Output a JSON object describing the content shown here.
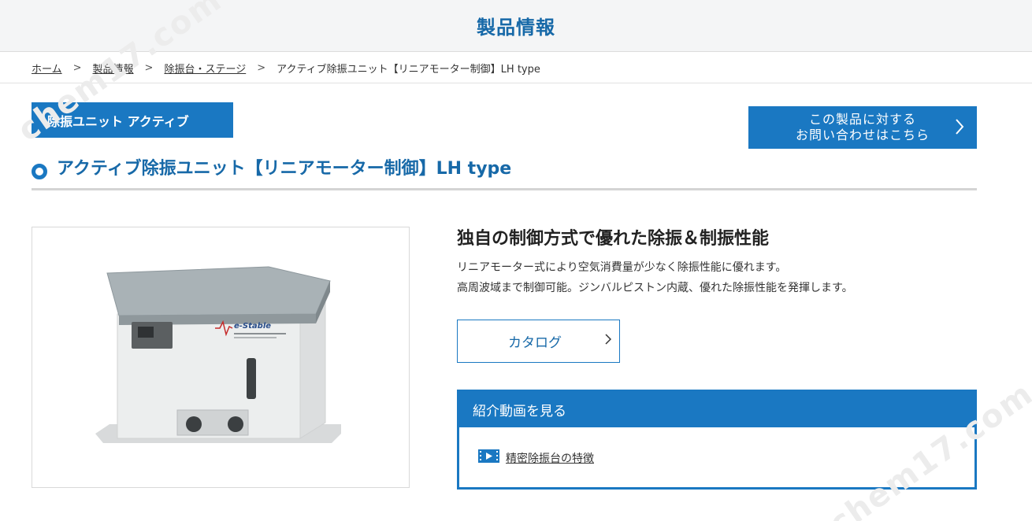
{
  "header": {
    "title": "製品情報"
  },
  "breadcrumb": {
    "items": [
      "ホーム",
      "製品情報",
      "除振台・ステージ"
    ],
    "current": "アクティブ除振ユニット【リニアモーター制御】LH type",
    "separator": ">"
  },
  "category_tag": "除振ユニット アクティブ",
  "contact": {
    "line1": "この製品に対する",
    "line2": "お問い合わせはこちら",
    "icon": "chevron-right-icon"
  },
  "product": {
    "title": "アクティブ除振ユニット【リニアモーター制御】LH type",
    "image_label": "e-Stable"
  },
  "feature": {
    "heading": "独自の制御方式で優れた除振＆制振性能",
    "line1": "リニアモーター式により空気消費量が少なく除振性能に優れます。",
    "line2": "高周波域まで制御可能。ジンバルピストン内蔵、優れた除振性能を発揮します。"
  },
  "catalog": {
    "label": "カタログ",
    "icon": "chevron-right-icon"
  },
  "video": {
    "heading": "紹介動画を見る",
    "link_label": "精密除振台の特徴",
    "icon": "film-icon"
  },
  "watermark": "chem17.com",
  "colors": {
    "brand_blue": "#1a78c2",
    "title_blue": "#1769a8",
    "header_bg": "#f4f5f6"
  }
}
